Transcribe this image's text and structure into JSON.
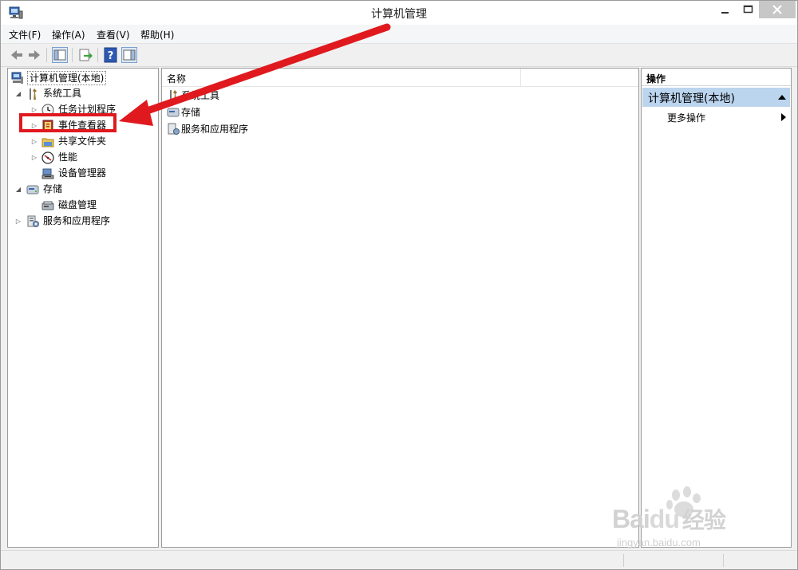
{
  "window": {
    "title": "计算机管理"
  },
  "menu": [
    {
      "label": "文件(F)"
    },
    {
      "label": "操作(A)"
    },
    {
      "label": "查看(V)"
    },
    {
      "label": "帮助(H)"
    }
  ],
  "tree": {
    "root": "计算机管理(本地)",
    "system_tools": "系统工具",
    "task_scheduler": "任务计划程序",
    "event_viewer": "事件查看器",
    "shared_folders": "共享文件夹",
    "performance": "性能",
    "device_manager": "设备管理器",
    "storage": "存储",
    "disk_management": "磁盘管理",
    "services_apps": "服务和应用程序"
  },
  "list": {
    "column_name": "名称",
    "rows": [
      "系统工具",
      "存储",
      "服务和应用程序"
    ]
  },
  "actions": {
    "header": "操作",
    "section": "计算机管理(本地)",
    "more": "更多操作"
  },
  "watermark": {
    "brand": "Bai",
    "brand2": "du",
    "suffix": "经验",
    "url": "jingyan.baidu.com"
  },
  "colors": {
    "annotation": "#e0191f",
    "selection": "#bcd5ef"
  }
}
